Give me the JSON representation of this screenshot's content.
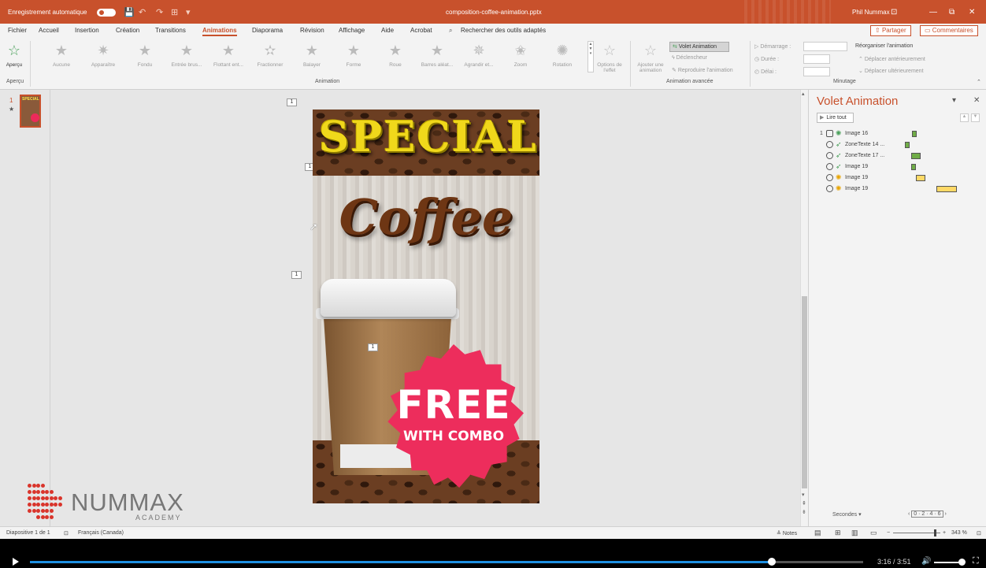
{
  "titlebar": {
    "autosave_label": "Enregistrement automatique",
    "filename": "composition-coffee-animation.pptx",
    "user": "Phil Nummax",
    "min": "—",
    "max": "⧉",
    "close": "✕"
  },
  "tabs": [
    "Fichier",
    "Accueil",
    "Insertion",
    "Création",
    "Transitions",
    "Animations",
    "Diaporama",
    "Révision",
    "Affichage",
    "Aide",
    "Acrobat"
  ],
  "search_placeholder": "Rechercher des outils adaptés",
  "share_label": "Partager",
  "comments_label": "Commentaires",
  "ribbon": {
    "apercu_label": "Aperçu",
    "apercu_group": "Aperçu",
    "animation_group": "Animation",
    "advanced_group": "Animation avancée",
    "timing_group": "Minutage",
    "effects": [
      "Aucune",
      "Apparaître",
      "Fondu",
      "Entrée brus...",
      "Flottant ent...",
      "Fractionner",
      "Balayer",
      "Forme",
      "Roue",
      "Barres aléat...",
      "Agrandir et...",
      "Zoom",
      "Rotation"
    ],
    "effect_options_1": "Options de",
    "effect_options_2": "l'effet",
    "add_anim_1": "Ajouter une",
    "add_anim_2": "animation",
    "volet_label": "Volet Animation",
    "declencheur": "Déclencheur",
    "reproduire": "Reproduire l'animation",
    "demarrage": "Démarrage :",
    "duree": "Durée :",
    "delai": "Délai :",
    "reorganiser": "Réorganiser l'animation",
    "deplacer_ant": "Déplacer antérieurement",
    "deplacer_ult": "Déplacer ultérieurement"
  },
  "thumbs": {
    "slide_num": "1",
    "star": "★"
  },
  "slide": {
    "special": "SPECIAL",
    "coffee": "Coffee",
    "free": "FREE",
    "combo": "WITH COMBO",
    "markers": [
      "1",
      "1",
      "1",
      "1"
    ]
  },
  "logo": {
    "name": "NUMMAX",
    "sub": "ACADEMY"
  },
  "animpane": {
    "title": "Volet Animation",
    "play_all": "Lire tout",
    "rows": [
      {
        "num": "1",
        "name": "Image 16",
        "color": "#70ad47"
      },
      {
        "num": "",
        "name": "ZoneTexte 14 ...",
        "color": "#70ad47"
      },
      {
        "num": "",
        "name": "ZoneTexte 17 ...",
        "color": "#70ad47"
      },
      {
        "num": "",
        "name": "Image 19",
        "color": "#70ad47"
      },
      {
        "num": "",
        "name": "Image 19",
        "color": "#ffc000"
      },
      {
        "num": "",
        "name": "Image 19",
        "color": "#ffc000"
      }
    ],
    "seconds_label": "Secondes",
    "scale": "0 · 2 · 4 · 6"
  },
  "statusbar": {
    "slide_info": "Diapositive 1 de 1",
    "language": "Français (Canada)",
    "notes": "Notes",
    "zoom": "343 %"
  },
  "video": {
    "time": "3:16 / 3:51",
    "progress": 0.89
  },
  "colors": {
    "accent": "#c8512c",
    "progress": "#1e8fe1"
  }
}
